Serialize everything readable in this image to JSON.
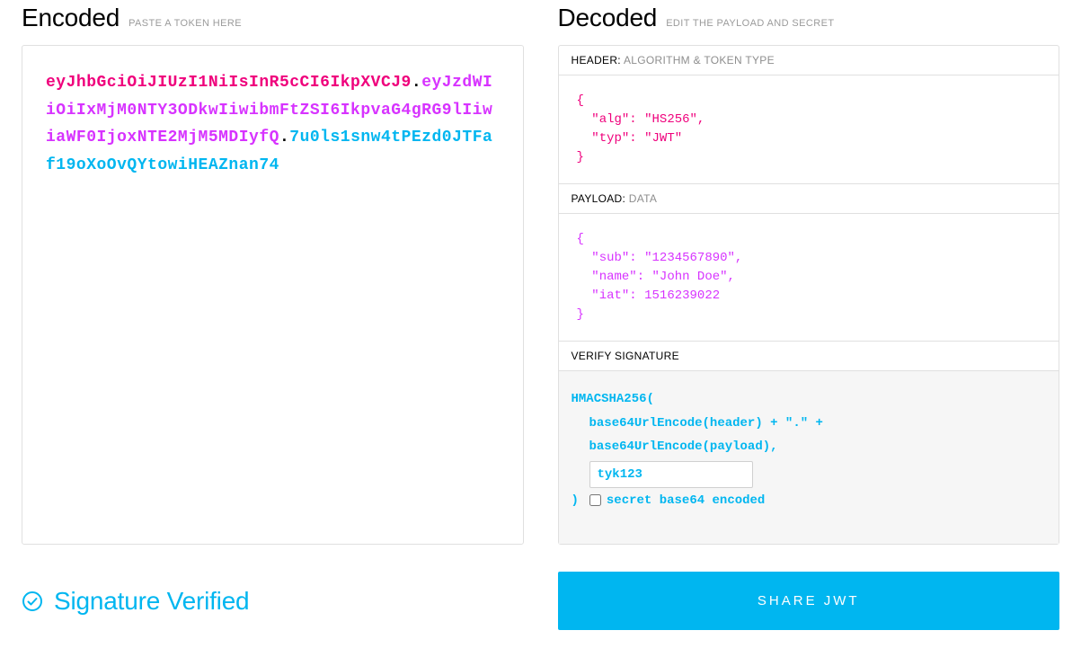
{
  "encoded": {
    "title": "Encoded",
    "hint": "PASTE A TOKEN HERE",
    "token_header": "eyJhbGciOiJIUzI1NiIsInR5cCI6IkpXVCJ9",
    "token_payload": "eyJzdWIiOiIxMjM0NTY3ODkwIiwibmFtZSI6IkpvaG4gRG9lIiwiaWF0IjoxNTE2MjM5MDIyfQ",
    "token_signature": "7u0ls1snw4tPEzd0JTFaf19oXoOvQYtowiHEAZnan74"
  },
  "decoded": {
    "title": "Decoded",
    "hint": "EDIT THE PAYLOAD AND SECRET",
    "header": {
      "label_primary": "HEADER:",
      "label_secondary": "ALGORITHM & TOKEN TYPE",
      "json": "{\n  \"alg\": \"HS256\",\n  \"typ\": \"JWT\"\n}"
    },
    "payload": {
      "label_primary": "PAYLOAD:",
      "label_secondary": "DATA",
      "json": "{\n  \"sub\": \"1234567890\",\n  \"name\": \"John Doe\",\n  \"iat\": 1516239022\n}"
    },
    "signature": {
      "label": "VERIFY SIGNATURE",
      "line1": "HMACSHA256(",
      "line2": "base64UrlEncode(header) + \".\" +",
      "line3": "base64UrlEncode(payload),",
      "secret_value": "tyk123",
      "close_paren": ")",
      "b64_label": "secret base64 encoded"
    }
  },
  "footer": {
    "verified_text": "Signature Verified",
    "share_label": "SHARE JWT"
  },
  "colors": {
    "header": "#ef007c",
    "payload": "#d733ff",
    "signature": "#00b6f0"
  }
}
